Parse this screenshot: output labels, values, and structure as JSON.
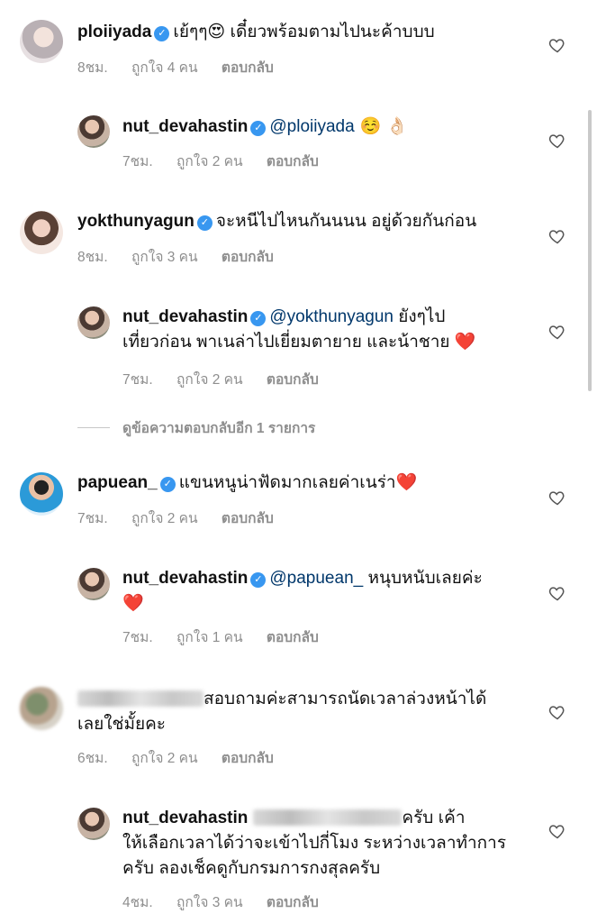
{
  "comments": [
    {
      "username": "ploiiyada",
      "verified": true,
      "text": "เย้ๆๆ😍  เดี๋ยวพร้อมตามไปนะค้าบบบ",
      "time": "8ชม.",
      "likes": "ถูกใจ 4 คน",
      "reply": "ตอบกลับ"
    },
    {
      "username": "nut_devahastin",
      "verified": true,
      "mention": "@ploiiyada",
      "text": " ☺️ 👌🏻",
      "time": "7ชม.",
      "likes": "ถูกใจ 2 คน",
      "reply": "ตอบกลับ"
    },
    {
      "username": "yokthunyagun",
      "verified": true,
      "text": "จะหนีไปไหนกันนนน อยู่ด้วยกันก่อน",
      "time": "8ชม.",
      "likes": "ถูกใจ 3 คน",
      "reply": "ตอบกลับ"
    },
    {
      "username": "nut_devahastin",
      "verified": true,
      "mention": "@yokthunyagun",
      "text_line1": " ยังๆไป",
      "text_line2": "เที่ยวก่อน พาเนล่าไปเยี่ยมตายาย และน้าชาย ❤️",
      "time": "7ชม.",
      "likes": "ถูกใจ 2 คน",
      "reply": "ตอบกลับ"
    },
    {
      "username": "papuean_",
      "verified": true,
      "text": "แขนหนูน่าฟัดมากเลยค่าเนร่า❤️",
      "time": "7ชม.",
      "likes": "ถูกใจ 2 คน",
      "reply": "ตอบกลับ"
    },
    {
      "username": "nut_devahastin",
      "verified": true,
      "mention": "@papuean_",
      "text_line1": " หนุบหนับเลยค่ะ",
      "text_line2": "❤️",
      "time": "7ชม.",
      "likes": "ถูกใจ 1 คน",
      "reply": "ตอบกลับ"
    },
    {
      "text_line1": "สอบถามค่ะสามารถนัดเวลาล่วงหน้าได้",
      "text_line2": "เลยใช่มั้ยคะ",
      "time": "6ชม.",
      "likes": "ถูกใจ 2 คน",
      "reply": "ตอบกลับ"
    },
    {
      "username": "nut_devahastin",
      "text_line1": "ครับ เค้า",
      "text_line2": "ให้เลือกเวลาได้ว่าจะเข้าไปกี่โมง ระหว่างเวลาทำการ",
      "text_line3": "ครับ ลองเช็คดูกับกรมการกงสุลครับ",
      "time": "4ชม.",
      "likes": "ถูกใจ 3 คน",
      "reply": "ตอบกลับ"
    }
  ],
  "view_more_replies": "ดูข้อความตอบกลับอีก 1 รายการ",
  "colors": {
    "verified": "#3897f0",
    "mention": "#00376b",
    "meta": "#8e8e8e"
  },
  "icons": {
    "like": "heart-outline-icon",
    "verified": "verified-badge-icon"
  }
}
